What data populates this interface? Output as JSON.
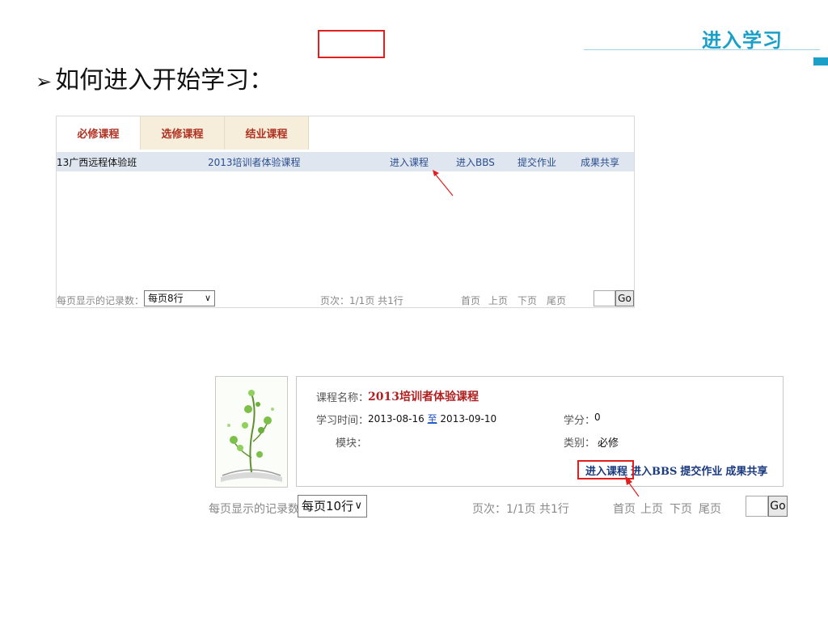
{
  "slide": {
    "tag": "进入学习",
    "heading_bullet": "➢",
    "heading": "如何进入开始学习："
  },
  "shot1": {
    "tabs": [
      "必修课程",
      "选修课程",
      "结业课程"
    ],
    "row": {
      "class_name": "13广西远程体验班",
      "course_name": "2013培训者体验课程",
      "enter_course": "进入课程",
      "enter_bbs": "进入BBS",
      "submit_homework": "提交作业",
      "share_results": "成果共享"
    },
    "pager": {
      "per_page_label": "每页显示的记录数：",
      "per_page_value": "每页8行",
      "page_info": "页次：1/1页 共1行",
      "first": "首页",
      "prev": "上页",
      "next": "下页",
      "last": "尾页",
      "go": "Go"
    }
  },
  "shot2": {
    "name_label": "课程名称：",
    "name_value": "2013培训者体验课程",
    "time_label": "学习时间：",
    "time_start": "2013-08-16",
    "time_to": "至",
    "time_end": "2013-09-10",
    "module_label": "模块：",
    "credit_label": "学分：",
    "credit_value": "0",
    "category_label": "类别：",
    "category_value": "必修",
    "enter_course": "进入课程",
    "enter_bbs": "进入BBS",
    "submit_homework": "提交作业",
    "share_results": "成果共享",
    "pager": {
      "per_page_label": "每页显示的记录数：",
      "per_page_value": "每页10行",
      "page_info": "页次：1/1页 共1行",
      "first": "首页",
      "prev": "上页",
      "next": "下页",
      "last": "尾页",
      "go": "Go"
    }
  },
  "colors": {
    "accent": "#1aa0c8",
    "highlight": "#e02020",
    "tab_text": "#b03020",
    "link": "#2a4d8f"
  }
}
